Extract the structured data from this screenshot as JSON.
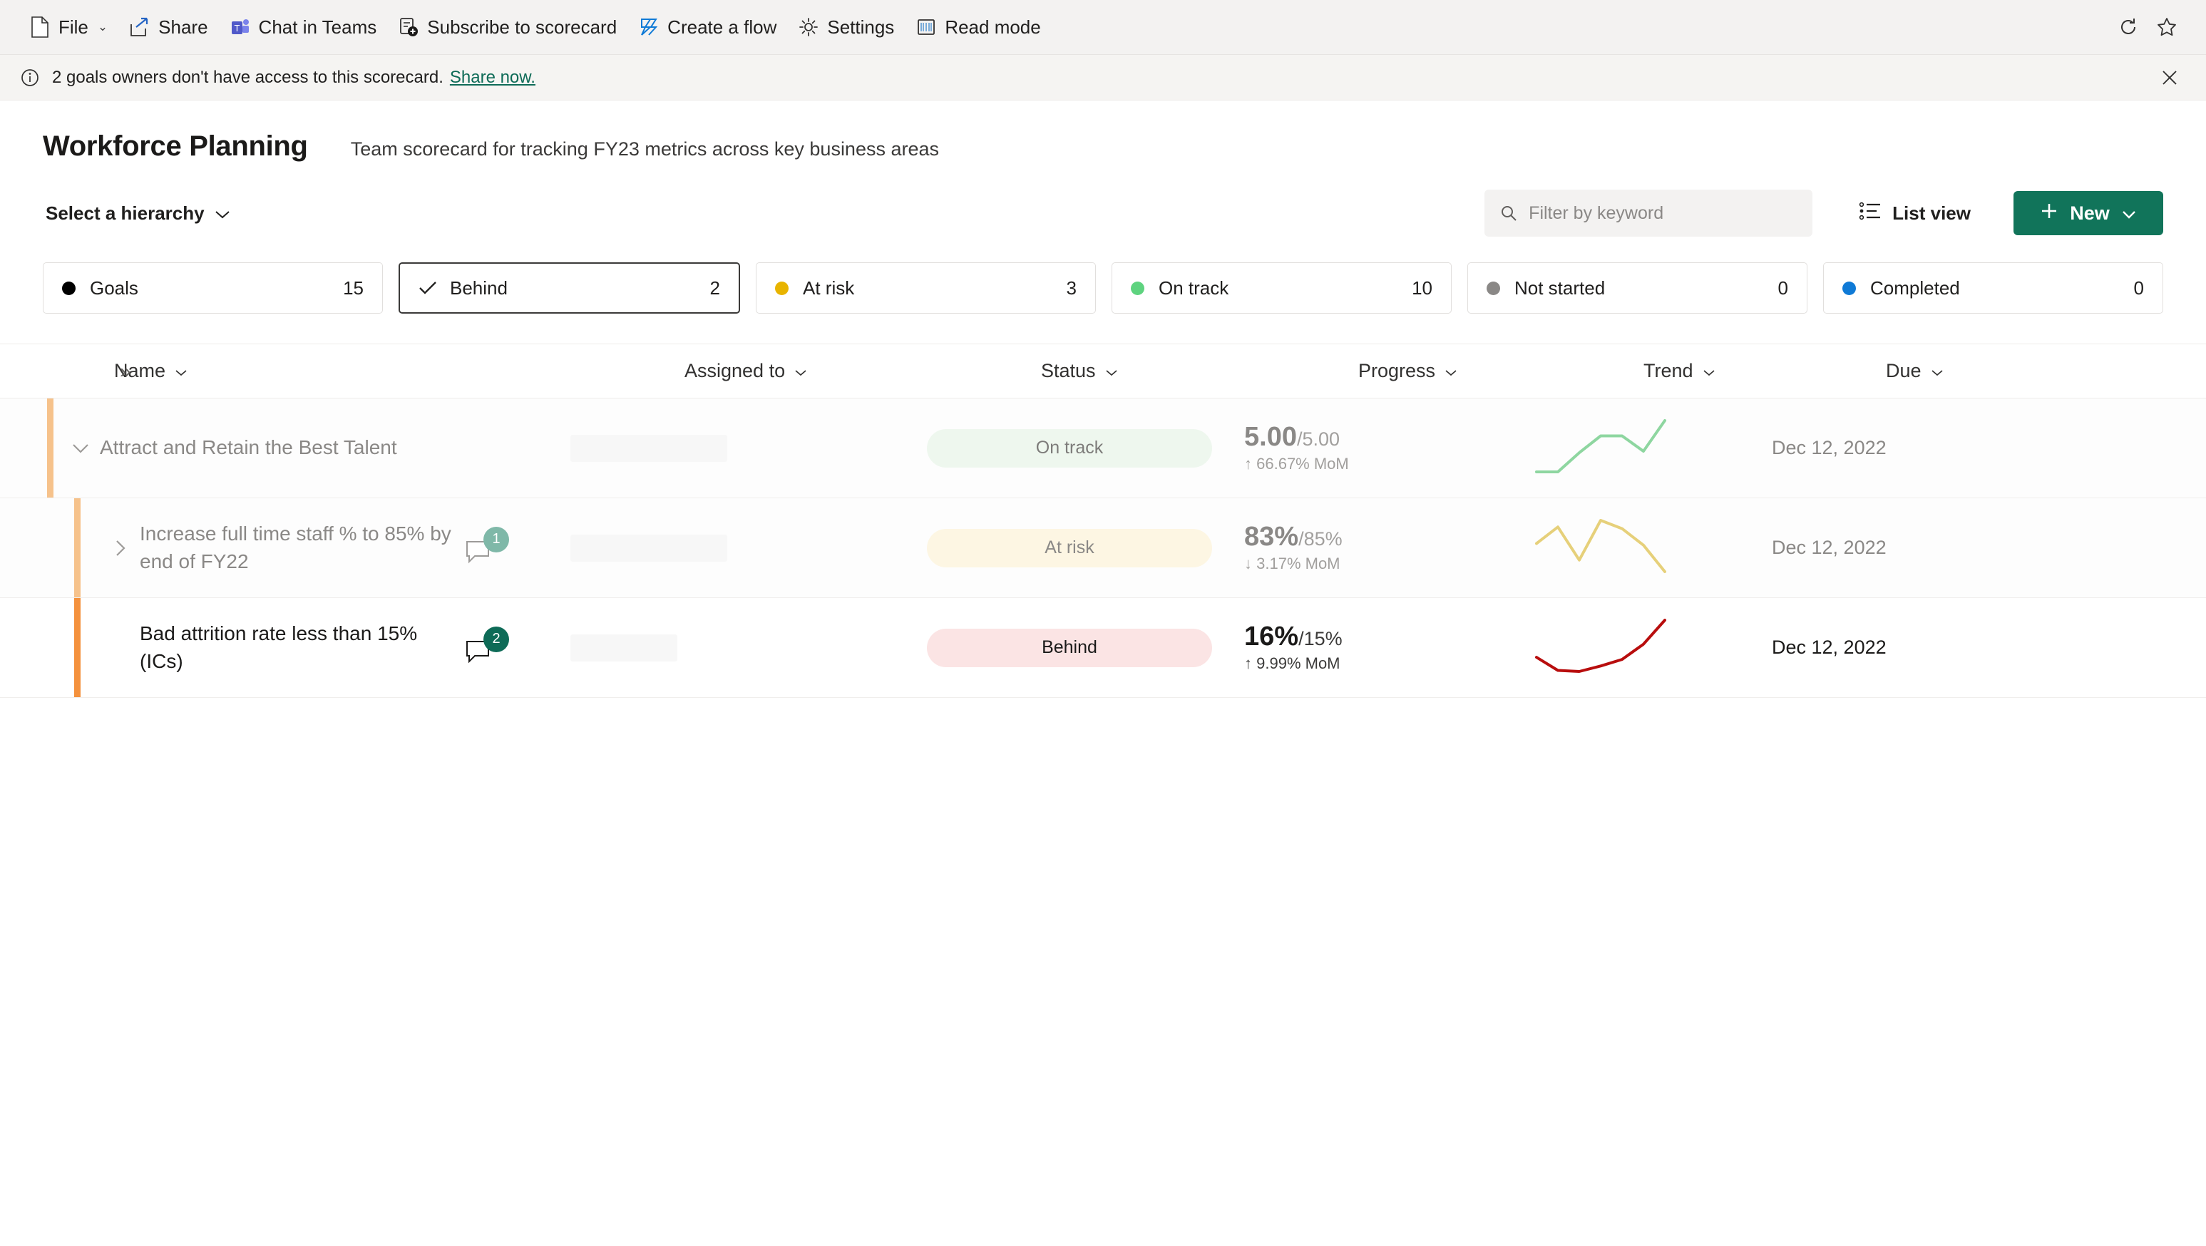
{
  "commandbar": {
    "items": [
      {
        "label": "File",
        "icon": "file-icon",
        "has_caret": true
      },
      {
        "label": "Share",
        "icon": "share-icon",
        "has_caret": false
      },
      {
        "label": "Chat in Teams",
        "icon": "teams-icon",
        "has_caret": false
      },
      {
        "label": "Subscribe to scorecard",
        "icon": "subscribe-icon",
        "has_caret": false
      },
      {
        "label": "Create a flow",
        "icon": "power-automate-icon",
        "has_caret": false
      },
      {
        "label": "Settings",
        "icon": "gear-icon",
        "has_caret": false
      },
      {
        "label": "Read mode",
        "icon": "read-mode-icon",
        "has_caret": false
      }
    ],
    "right_icons": [
      {
        "name": "refresh-icon"
      },
      {
        "name": "favorite-star-icon"
      }
    ]
  },
  "messagebar": {
    "icon": "info-icon",
    "text": "2 goals owners don't have access to this scorecard.",
    "link": "Share now.",
    "close_icon": "close-icon"
  },
  "header": {
    "title": "Workforce Planning",
    "description": "Team scorecard for tracking FY23 metrics across key business areas",
    "hierarchy_label": "Select a hierarchy"
  },
  "toolbar": {
    "search_placeholder": "Filter by keyword",
    "search_value": "",
    "search_icon": "search-icon",
    "list_view_label": "List view",
    "list_view_icon": "list-view-icon",
    "new_label": "New",
    "new_plus_icon": "plus-icon",
    "new_caret_icon": "chevron-down-icon",
    "accent_color": "#11745a"
  },
  "chips": [
    {
      "label": "Goals",
      "count": "15",
      "color": "#000000",
      "selected": false,
      "marker": "dot"
    },
    {
      "label": "Behind",
      "count": "2",
      "color": "#d13438",
      "selected": true,
      "marker": "check"
    },
    {
      "label": "At risk",
      "count": "3",
      "color": "#e8b400",
      "selected": false,
      "marker": "dot"
    },
    {
      "label": "On track",
      "count": "10",
      "color": "#5ed37f",
      "selected": false,
      "marker": "dot"
    },
    {
      "label": "Not started",
      "count": "0",
      "color": "#8a8886",
      "selected": false,
      "marker": "dot"
    },
    {
      "label": "Completed",
      "count": "0",
      "color": "#0f7ad6",
      "selected": false,
      "marker": "dot"
    }
  ],
  "table": {
    "expand_all_icon": "expand-all-icon",
    "columns": [
      {
        "label": "Name",
        "sort_icon": "chevron-down-icon"
      },
      {
        "label": "Assigned to",
        "sort_icon": "chevron-down-icon"
      },
      {
        "label": "Status",
        "sort_icon": "chevron-down-icon"
      },
      {
        "label": "Progress",
        "sort_icon": "chevron-down-icon"
      },
      {
        "label": "Trend",
        "sort_icon": "chevron-down-icon"
      },
      {
        "label": "Due",
        "sort_icon": "chevron-down-icon"
      }
    ],
    "rows": [
      {
        "name": "Attract and Retain the Best Talent",
        "indent": 0,
        "expander": "chevron-down-icon",
        "accent_color": "#f6c28b",
        "dimmed": true,
        "comment_count": "",
        "comment_badge_color": "",
        "status": "On track",
        "status_bg": "#eef7ee",
        "status_text_color": "#7d7c7a",
        "progress_value": "5.00",
        "progress_target": "/5.00",
        "delta_arrow": "↑",
        "delta_text": "66.67% MoM",
        "trend_color": "#8ed6a0",
        "trend_points": [
          5,
          5,
          30,
          52,
          52,
          32,
          72
        ],
        "due": "Dec 12, 2022"
      },
      {
        "name": "Increase full time staff % to 85% by end of FY22",
        "indent": 1,
        "expander": "chevron-right-icon",
        "accent_color": "#f6c28b",
        "dimmed": true,
        "comment_count": "1",
        "comment_badge_color": "#7fb8a8",
        "status": "At risk",
        "status_bg": "#fdf6e3",
        "status_text_color": "#8a8886",
        "progress_value": "83%",
        "progress_target": "/85%",
        "delta_arrow": "↓",
        "delta_text": "3.17% MoM",
        "trend_color": "#e6d07a",
        "trend_points": [
          42,
          62,
          22,
          70,
          60,
          40,
          8
        ],
        "due": "Dec 12, 2022"
      },
      {
        "name": "Bad attrition rate less than 15% (ICs)",
        "indent": 1,
        "expander": "",
        "accent_color": "#f4913d",
        "dimmed": false,
        "comment_count": "2",
        "comment_badge_color": "#0e6b57",
        "status": "Behind",
        "status_bg": "#fbe4e4",
        "status_text_color": "#1b1a19",
        "progress_value": "16%",
        "progress_target": "/15%",
        "delta_arrow": "↑",
        "delta_text": "9.99% MoM",
        "trend_color": "#b80d0d",
        "trend_points": [
          22,
          10,
          9,
          14,
          20,
          34,
          56
        ],
        "due": "Dec 12, 2022"
      }
    ]
  }
}
